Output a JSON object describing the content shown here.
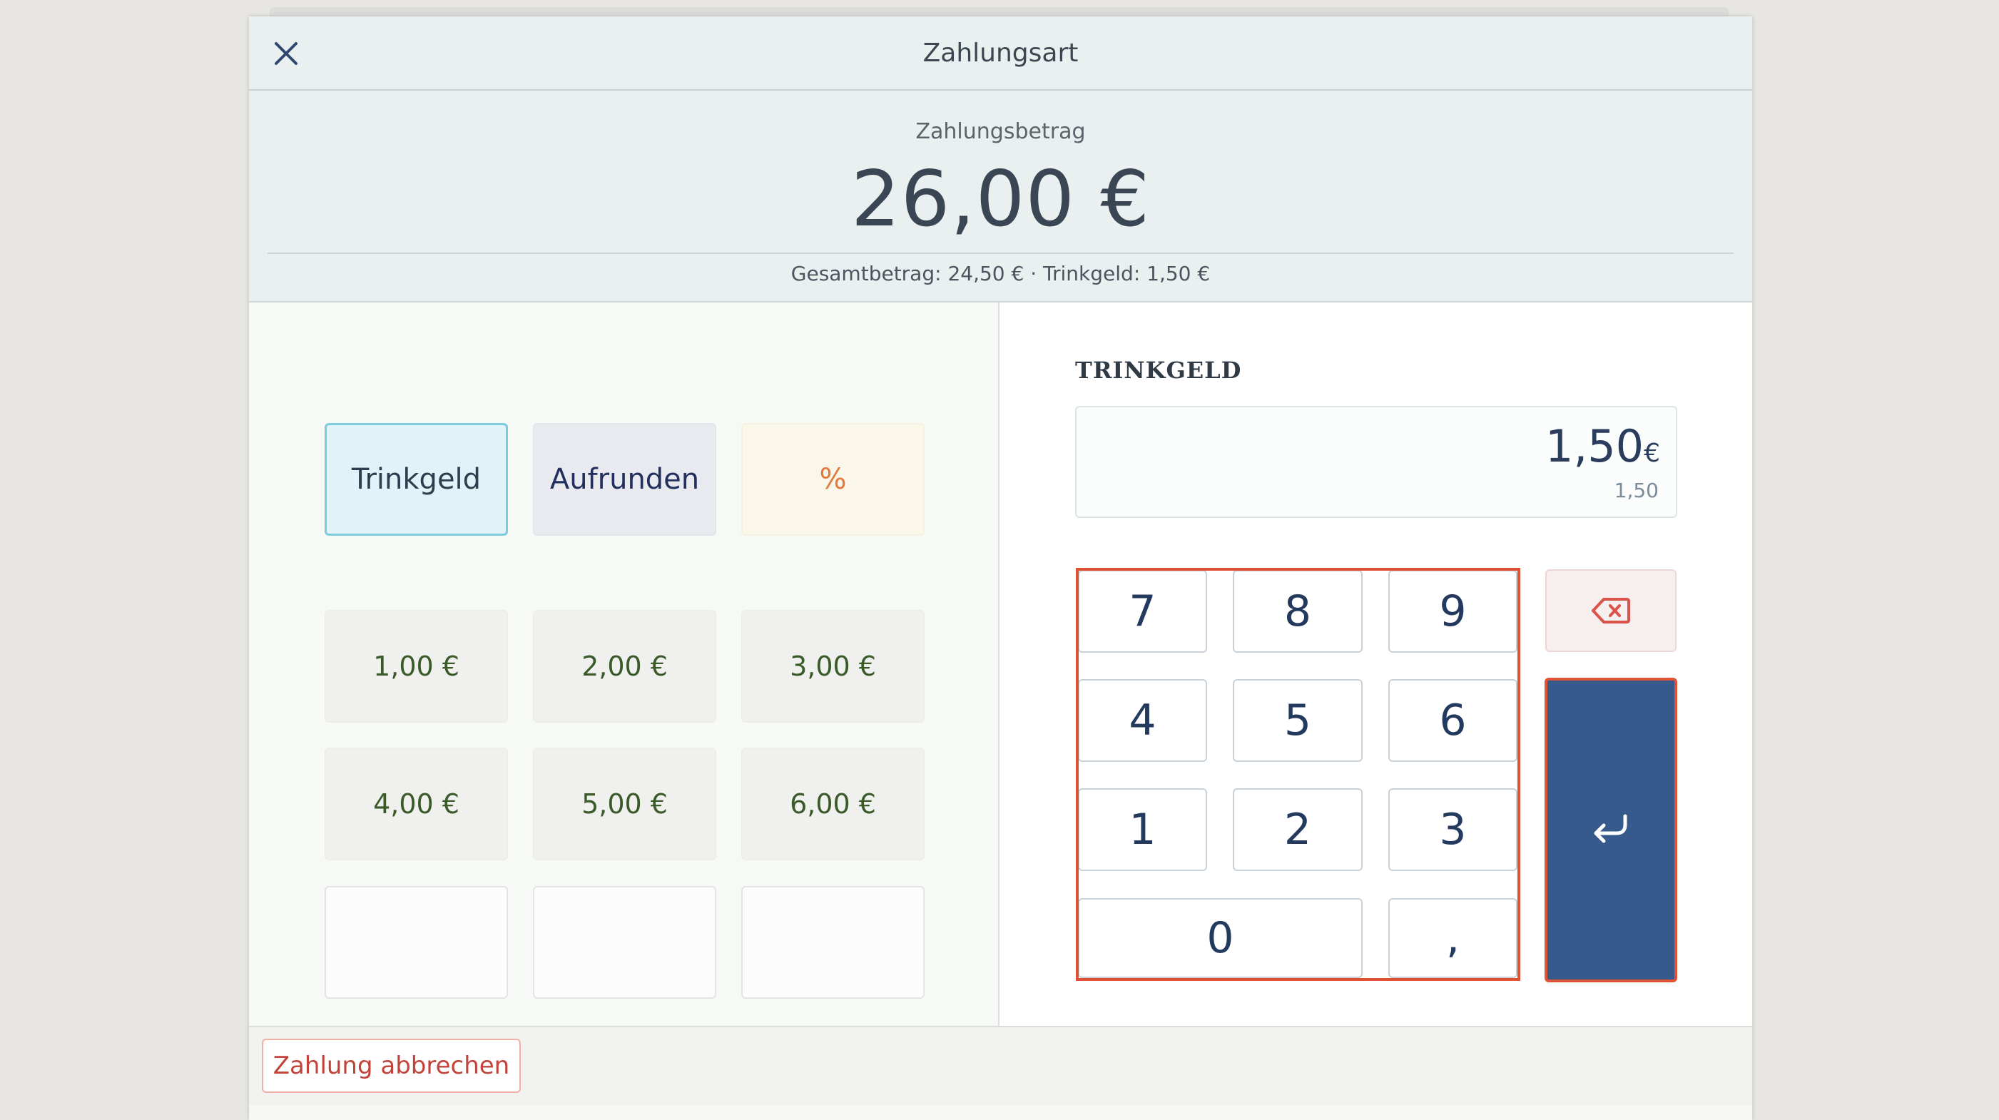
{
  "header": {
    "title": "Zahlungsart",
    "close_icon": "close-icon"
  },
  "payment": {
    "label": "Zahlungsbetrag",
    "amount": "26,00 €",
    "summary": "Gesamtbetrag: 24,50 € · Trinkgeld: 1,50 €"
  },
  "modes": {
    "trinkgeld": "Trinkgeld",
    "aufrunden": "Aufrunden",
    "percent": "%"
  },
  "presets": [
    "1,00 €",
    "2,00 €",
    "3,00 €",
    "4,00 €",
    "5,00 €",
    "6,00 €"
  ],
  "tip_field": {
    "label": "TRINKGELD",
    "value": "1,50",
    "currency": "€",
    "secondary": "1,50"
  },
  "numpad": {
    "keys": [
      "7",
      "8",
      "9",
      "4",
      "5",
      "6",
      "1",
      "2",
      "3",
      "0",
      ","
    ],
    "backspace_icon": "backspace-icon",
    "enter_icon": "enter-icon"
  },
  "footer": {
    "cancel_label": "Zahlung abbrechen"
  },
  "colors": {
    "accent_blue": "#365a8c",
    "highlight_red": "#e05236",
    "preset_text_green": "#3a5a2a",
    "percent_orange": "#e0793c",
    "cancel_red": "#c2433a"
  }
}
